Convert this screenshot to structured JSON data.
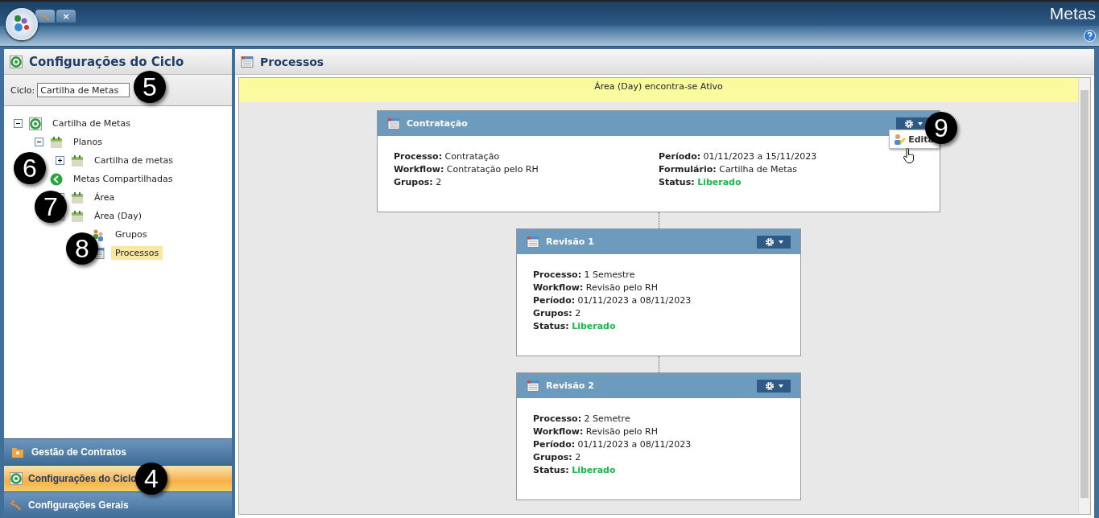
{
  "app": {
    "title": "Metas",
    "tabs": [
      {
        "kind": "tools",
        "selected": true
      },
      {
        "kind": "close",
        "label": "×",
        "selected": false
      }
    ]
  },
  "sidebar": {
    "title": "Configurações do Ciclo",
    "ciclo": {
      "label": "Ciclo:",
      "value": "Cartilha de Metas"
    },
    "tree": [
      {
        "label": "Cartilha de Metas",
        "kind": "cycle",
        "expanded": true,
        "selected": false,
        "children": [
          {
            "label": "Planos",
            "kind": "plan",
            "expanded": true,
            "selected": false,
            "children": [
              {
                "label": "Cartilha de metas",
                "kind": "plan",
                "expanded": false,
                "selected": false
              }
            ]
          },
          {
            "label": "Metas Compartilhadas",
            "kind": "share",
            "selected": false,
            "children": [
              {
                "label": "Área",
                "kind": "plan",
                "expanded": false,
                "selected": false
              },
              {
                "label": "Área (Day)",
                "kind": "plan",
                "expanded": true,
                "selected": false,
                "children": [
                  {
                    "label": "Grupos",
                    "kind": "groups",
                    "selected": false
                  },
                  {
                    "label": "Processos",
                    "kind": "process",
                    "selected": true
                  }
                ]
              }
            ]
          }
        ]
      }
    ],
    "accordion": [
      {
        "label": "Gestão de Contratos",
        "kind": "contracts",
        "selected": false
      },
      {
        "label": "Configurações do Ciclo",
        "kind": "cycle",
        "selected": true
      },
      {
        "label": "Configurações Gerais",
        "kind": "tools",
        "selected": false
      }
    ]
  },
  "main": {
    "title": "Processos",
    "banner": "Área (Day) encontra-se Ativo",
    "cards": [
      {
        "title": "Contratação",
        "columns": [
          [
            {
              "label": "Processo:",
              "value": "Contratação"
            },
            {
              "label": "Workflow:",
              "value": "Contratação pelo RH"
            },
            {
              "label": "Grupos:",
              "value": "2"
            }
          ],
          [
            {
              "label": "Período:",
              "value": "01/11/2023 a 15/11/2023"
            },
            {
              "label": "Formulário:",
              "value": "Cartilha de Metas"
            },
            {
              "label": "Status:",
              "value": "Liberado",
              "kind": "status"
            }
          ]
        ],
        "menu": {
          "items": [
            "Edita"
          ]
        }
      },
      {
        "title": "Revisão 1",
        "columns": [
          [
            {
              "label": "Processo:",
              "value": "1 Semestre"
            },
            {
              "label": "Workflow:",
              "value": "Revisão pelo RH"
            },
            {
              "label": "Período:",
              "value": "01/11/2023 a 08/11/2023"
            },
            {
              "label": "Grupos:",
              "value": "2"
            },
            {
              "label": "Status:",
              "value": "Liberado",
              "kind": "status"
            }
          ]
        ]
      },
      {
        "title": "Revisão 2",
        "columns": [
          [
            {
              "label": "Processo:",
              "value": "2 Semetre"
            },
            {
              "label": "Workflow:",
              "value": "Revisão pelo RH"
            },
            {
              "label": "Período:",
              "value": "01/11/2023 a 08/11/2023"
            },
            {
              "label": "Grupos:",
              "value": "2"
            },
            {
              "label": "Status:",
              "value": "Liberado",
              "kind": "status"
            }
          ]
        ]
      }
    ]
  },
  "callouts": [
    {
      "label": "5"
    },
    {
      "label": "6"
    },
    {
      "label": "7"
    },
    {
      "label": "8"
    },
    {
      "label": "9"
    },
    {
      "label": "4"
    }
  ]
}
